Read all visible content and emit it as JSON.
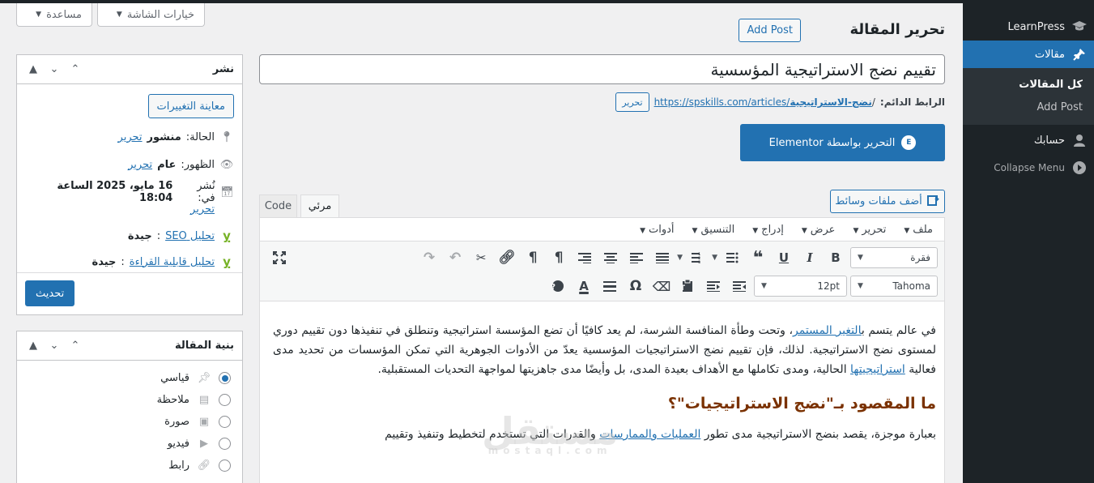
{
  "admin_menu": {
    "learnpress": "LearnPress",
    "posts": "مقالات",
    "submenu": [
      "كل المقالات",
      "Add Post"
    ],
    "account": "حسابك",
    "collapse": "Collapse Menu"
  },
  "screen_meta": {
    "screen_options": "خيارات الشاشة",
    "help": "مساعدة"
  },
  "header": {
    "title": "تحرير المقالة",
    "add_post": "Add Post"
  },
  "post": {
    "title": "تقييم نضج الاستراتيجية المؤسسية",
    "permalink_label": "الرابط الدائم:",
    "permalink_base": "https://spskills.com/articles/",
    "permalink_slug": "نضج-الاستراتيجية",
    "permalink_edit": "تحرير",
    "elementor": "التحرير بواسطة Elementor",
    "elementor_icon": "E"
  },
  "editor": {
    "add_media": "أضف ملفات وسائط",
    "tab_visual": "مرئي",
    "tab_code": "Code",
    "menus": [
      "ملف",
      "تحرير",
      "عرض",
      "إدراج",
      "التنسيق",
      "أدوات"
    ],
    "format_select": "فقرة",
    "font_select": "Tahoma",
    "size_select": "12pt",
    "p1_a": "في عالم يتسم ب",
    "p1_link1": "التغير المستمر",
    "p1_b": "، وتحت وطأة المنافسة الشرسة، لم يعد كافيًا أن تضع المؤسسة استراتيجية وتنطلق في تنفيذها دون تقييم دوري لمستوى نضج الاستراتيجية. لذلك، فإن تقييم نضج الاستراتيجيات المؤسسية يعدّ من الأدوات الجوهرية التي تمكن المؤسسات من تحديد مدى فعالية ",
    "p1_link2": "استراتيجيتها",
    "p1_c": " الحالية، ومدى تكاملها مع الأهداف بعيدة المدى، بل وأيضًا مدى جاهزيتها لمواجهة التحديات المستقبلية.",
    "h2": "ما المقصود بـ\"نضج الاستراتيجيات\"؟",
    "p2_a": "بعبارة موجزة، يقصد بنضج الاستراتيجية مدى تطور ",
    "p2_link": "العمليات والممارسات",
    "p2_b": " والقدرات التي تستخدم لتخطيط وتنفيذ وتقييم",
    "watermark": "مستقل",
    "watermark_sub": "mostaql.com"
  },
  "publish": {
    "title": "نشر",
    "preview": "معاينة التغييرات",
    "status_label": "الحالة:",
    "status_value": "منشور",
    "visibility_label": "الظهور:",
    "visibility_value": "عام",
    "published_label": "نُشر في:",
    "published_value": "16 مايو، 2025 الساعة 18:04",
    "edit": "تحرير",
    "seo_label": "تحليل SEO",
    "seo_value": "جيدة",
    "readability_label": "تحليل قابلية القراءة",
    "readability_value": "جيدة",
    "update": "تحديث"
  },
  "format": {
    "title": "بنية المقالة",
    "options": [
      "قياسي",
      "ملاحظة",
      "صورة",
      "فيديو",
      "رابط"
    ]
  }
}
